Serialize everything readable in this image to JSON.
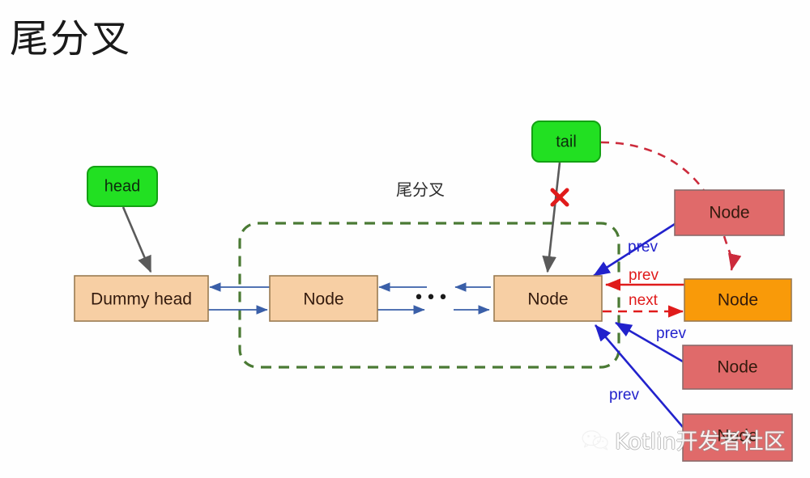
{
  "slide": {
    "title": "尾分叉",
    "background": "#fefefe"
  },
  "group": {
    "label": "尾分叉",
    "border_color": "#4a7a34",
    "style": "dashed"
  },
  "pointers": [
    {
      "id": "head",
      "label": "head",
      "fill": "#22e022",
      "stroke": "#13a113"
    },
    {
      "id": "tail",
      "label": "tail",
      "fill": "#22e022",
      "stroke": "#13a113"
    }
  ],
  "nodes": {
    "dummy_head": {
      "label": "Dummy head",
      "fill": "#f7cfa4",
      "stroke": "#9a7b52"
    },
    "chain_1": {
      "label": "Node",
      "fill": "#f7cfa4",
      "stroke": "#9a7b52"
    },
    "chain_2": {
      "label": "Node",
      "fill": "#f7cfa4",
      "stroke": "#9a7b52"
    },
    "detached_1": {
      "label": "Node",
      "fill": "#e06a6a",
      "stroke": "#8a6a6a"
    },
    "active": {
      "label": "Node",
      "fill": "#f99a09",
      "stroke": "#9a7b52"
    },
    "detached_2": {
      "label": "Node",
      "fill": "#e06a6a",
      "stroke": "#8a6a6a"
    },
    "detached_3": {
      "label": "Node",
      "fill": "#e06a6a",
      "stroke": "#8a6a6a"
    }
  },
  "ellipsis": "•••",
  "edge_labels": {
    "prev_top": "prev",
    "prev_mid": "prev",
    "next_mid": "next",
    "prev_low": "prev",
    "prev_bottom": "prev"
  },
  "markers": {
    "invalid_link": "✕",
    "invalid_link_color": "#e01b1b"
  },
  "colors": {
    "blue_arrow": "#2222cc",
    "red_arrow": "#e01b1b",
    "thin_blue": "#3a5fa8",
    "gray_arrow": "#5a5a5a",
    "dashed_red": "#cc2b3c",
    "group_green": "#4a7a34"
  },
  "watermark": {
    "icon": "wechat-icon",
    "text": "Kotlin开发者社区"
  }
}
